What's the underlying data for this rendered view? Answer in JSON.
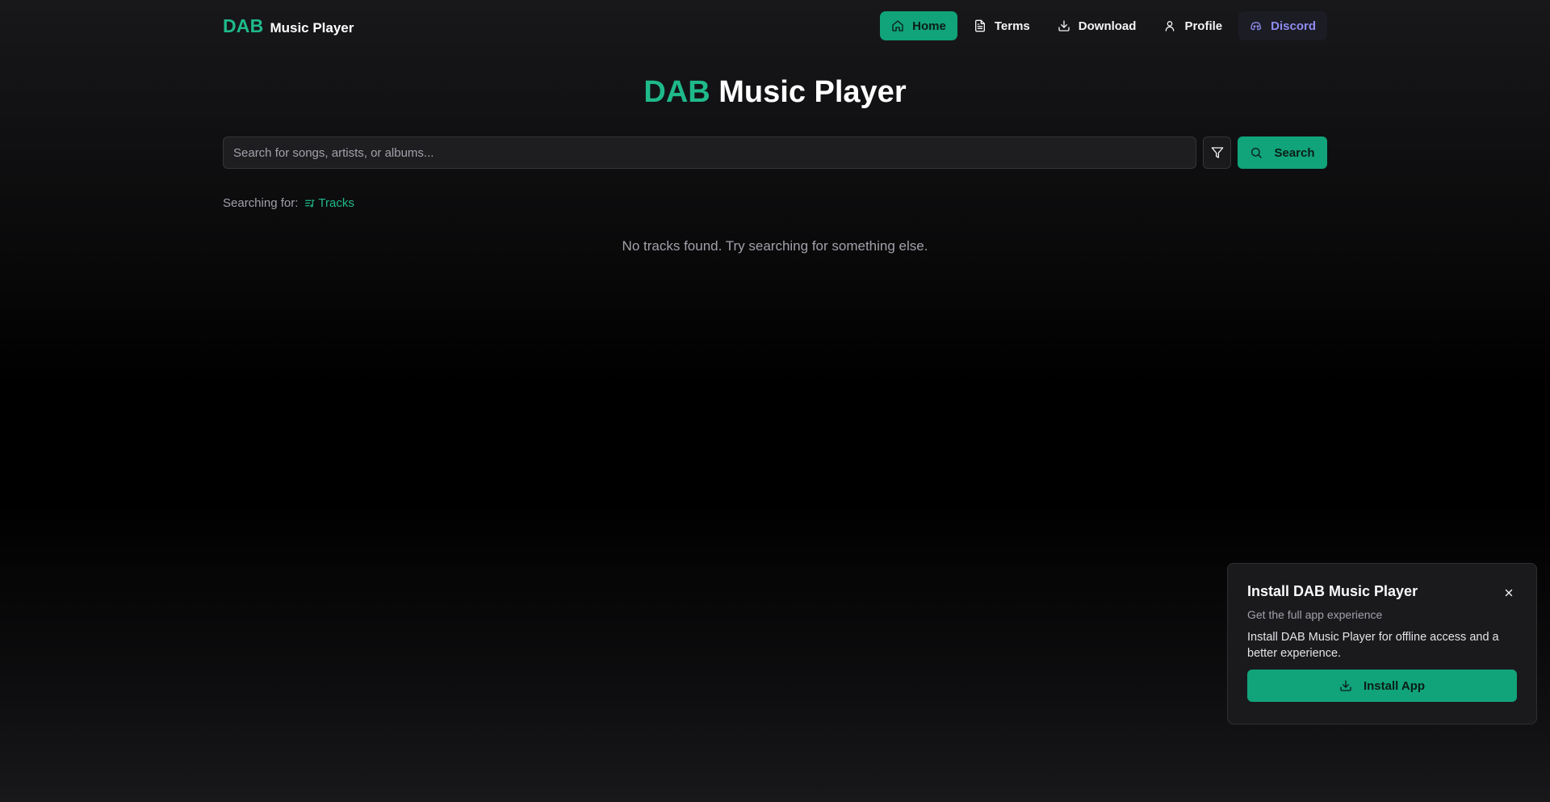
{
  "header": {
    "logo_accent": "DAB",
    "logo_text": "Music Player",
    "nav": [
      {
        "label": "Home",
        "icon": "home-icon"
      },
      {
        "label": "Terms",
        "icon": "document-icon"
      },
      {
        "label": "Download",
        "icon": "download-icon"
      },
      {
        "label": "Profile",
        "icon": "user-icon"
      },
      {
        "label": "Discord",
        "icon": "discord-icon"
      }
    ]
  },
  "hero": {
    "accent": "DAB",
    "text": "Music Player"
  },
  "search": {
    "placeholder": "Search for songs, artists, or albums...",
    "value": "",
    "button_label": "Search",
    "filter_icon": "filter-icon",
    "search_icon": "search-icon"
  },
  "filter_status": {
    "prefix": "Searching for:",
    "type_label": "Tracks",
    "type_icon": "list-music-icon"
  },
  "results": {
    "empty_message": "No tracks found. Try searching for something else."
  },
  "install_prompt": {
    "title": "Install DAB Music Player",
    "subtitle": "Get the full app experience",
    "description": "Install DAB Music Player for offline access and a better experience.",
    "button_label": "Install App",
    "close_icon": "close-icon"
  },
  "colors": {
    "accent": "#11a37a",
    "accent_text": "#1fb98a",
    "discord": "#8e8cf0",
    "background": "#000000"
  }
}
